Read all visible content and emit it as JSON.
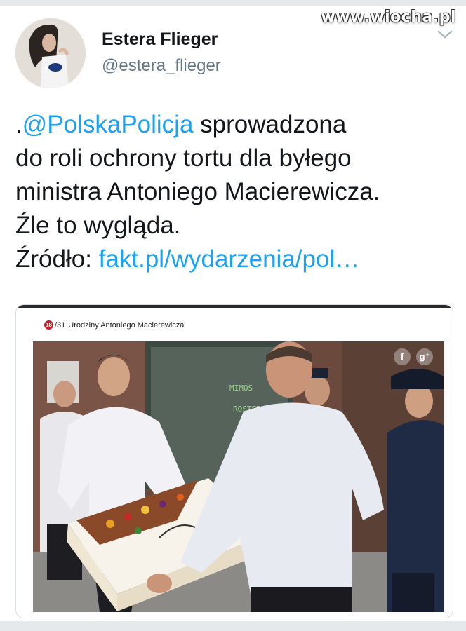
{
  "watermark": "www.wiocha.pl",
  "user": {
    "name": "Estera Flieger",
    "handle": "@estera_flieger"
  },
  "tweet": {
    "line1_prefix": ".",
    "mention": "@PolskaPolicja",
    "line1_suffix": " sprowadzona",
    "line2": "do roli ochrony tortu dla byłego",
    "line3": "ministra Antoniego Macierewicza.",
    "line4": "Źle to wygląda.",
    "line5_prefix": "Źródło: ",
    "link": "fakt.pl/wydarzenia/pol…"
  },
  "card": {
    "badge": "18",
    "counter": "/31",
    "caption": "Urodziny Antoniego Macierewicza",
    "social": {
      "facebook": "f",
      "google": "g⁺"
    }
  },
  "colors": {
    "link": "#1da1f2",
    "text": "#14171a",
    "handle": "#657786"
  },
  "icons": [
    "chevron-down-icon",
    "facebook-icon",
    "google-plus-icon"
  ]
}
